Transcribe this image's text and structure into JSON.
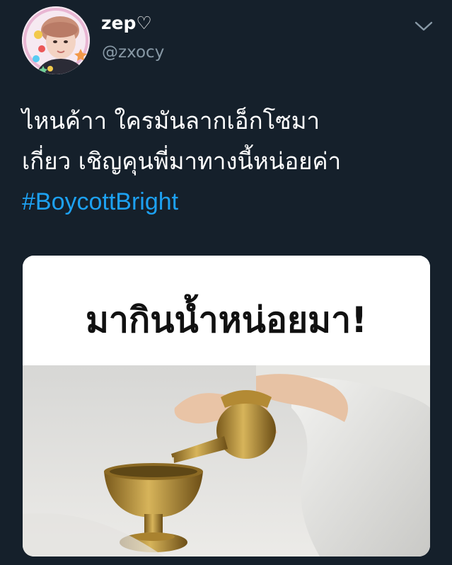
{
  "tweet": {
    "display_name": "zep♡",
    "handle": "@zxocy",
    "text_lines": [
      "ไหนค้าา ใครมันลากเอ็กโซมา",
      "เกี่ยว เชิญคุนพี่มาทางนี้หน่อยค่า"
    ],
    "hashtag": "#BoycottBright",
    "media": {
      "caption": "มากินน้ำหน่อยมา!"
    }
  },
  "icons": {
    "menu": "chevron-down-icon"
  },
  "colors": {
    "background": "#15202b",
    "text": "#ffffff",
    "secondary_text": "#8899a6",
    "link": "#1da1f2"
  }
}
